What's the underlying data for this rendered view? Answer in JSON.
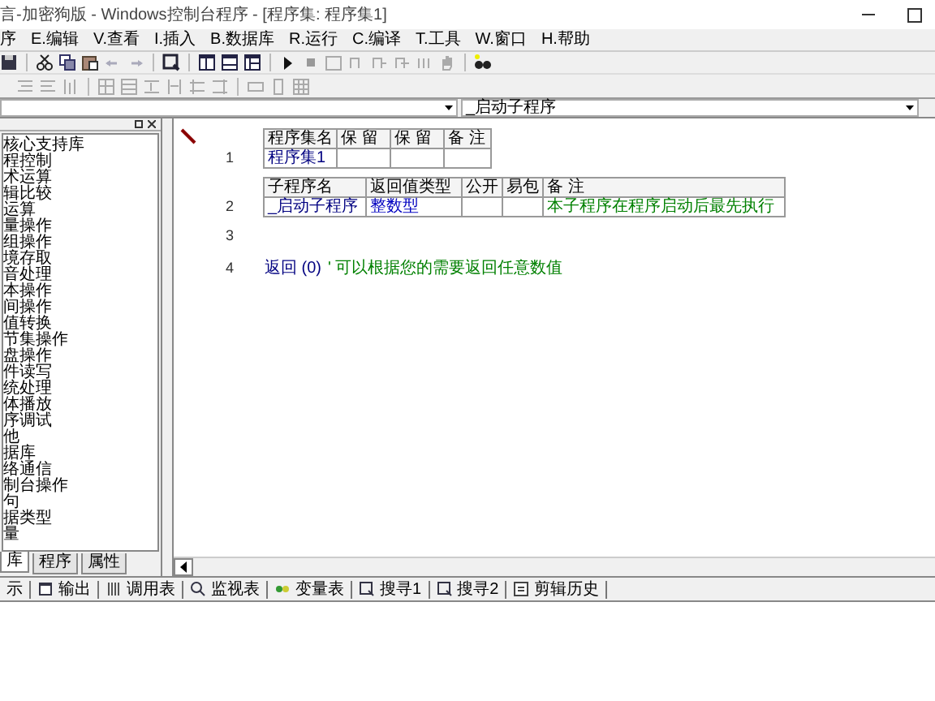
{
  "window": {
    "title": "言-加密狗版 - Windows控制台程序 - [程序集: 程序集1]"
  },
  "menu": [
    "序",
    "E.编辑",
    "V.查看",
    "I.插入",
    "B.数据库",
    "R.运行",
    "C.编译",
    "T.工具",
    "W.窗口",
    "H.帮助"
  ],
  "selectors": [
    {
      "value": "_启动子程序"
    }
  ],
  "library_panel": {
    "items": [
      "核心支持库",
      "程控制",
      "术运算",
      "辑比较",
      "运算",
      "量操作",
      "组操作",
      "境存取",
      "音处理",
      "本操作",
      "间操作",
      "值转换",
      "节集操作",
      "盘操作",
      "件读写",
      "统处理",
      "体播放",
      "序调试",
      "他",
      "据库",
      "络通信",
      "制台操作",
      "句",
      "据类型",
      "量"
    ],
    "tabs": [
      {
        "label": "库",
        "selected": true
      },
      {
        "label": "程序",
        "selected": false
      },
      {
        "label": "属性",
        "selected": false
      }
    ]
  },
  "editor": {
    "lines": [
      {
        "number": "1",
        "kind": "table",
        "columns": [
          "程序集名",
          "保 留",
          "保 留",
          "备 注"
        ],
        "cells": [
          {
            "text": "程序集1",
            "color": "#000080"
          },
          null,
          null,
          null
        ]
      },
      {
        "number": "2",
        "kind": "table",
        "columns": [
          "子程序名",
          "返回值类型",
          "公开",
          "易包",
          "备 注"
        ],
        "cells": [
          {
            "text": "_启动子程序",
            "color": "#000080"
          },
          {
            "text": "整数型",
            "color": "#0000c0"
          },
          null,
          null,
          {
            "text": "本子程序在程序启动后最先执行",
            "color": "#008000"
          }
        ]
      },
      {
        "number": "3",
        "kind": "blank"
      },
      {
        "number": "4",
        "kind": "code",
        "code": "返回 (0)",
        "comment": "' 可以根据您的需要返回任意数值"
      }
    ]
  },
  "bottom_tabs": [
    "示",
    "输出",
    "调用表",
    "监视表",
    "变量表",
    "搜寻1",
    "搜寻2",
    "剪辑历史"
  ]
}
